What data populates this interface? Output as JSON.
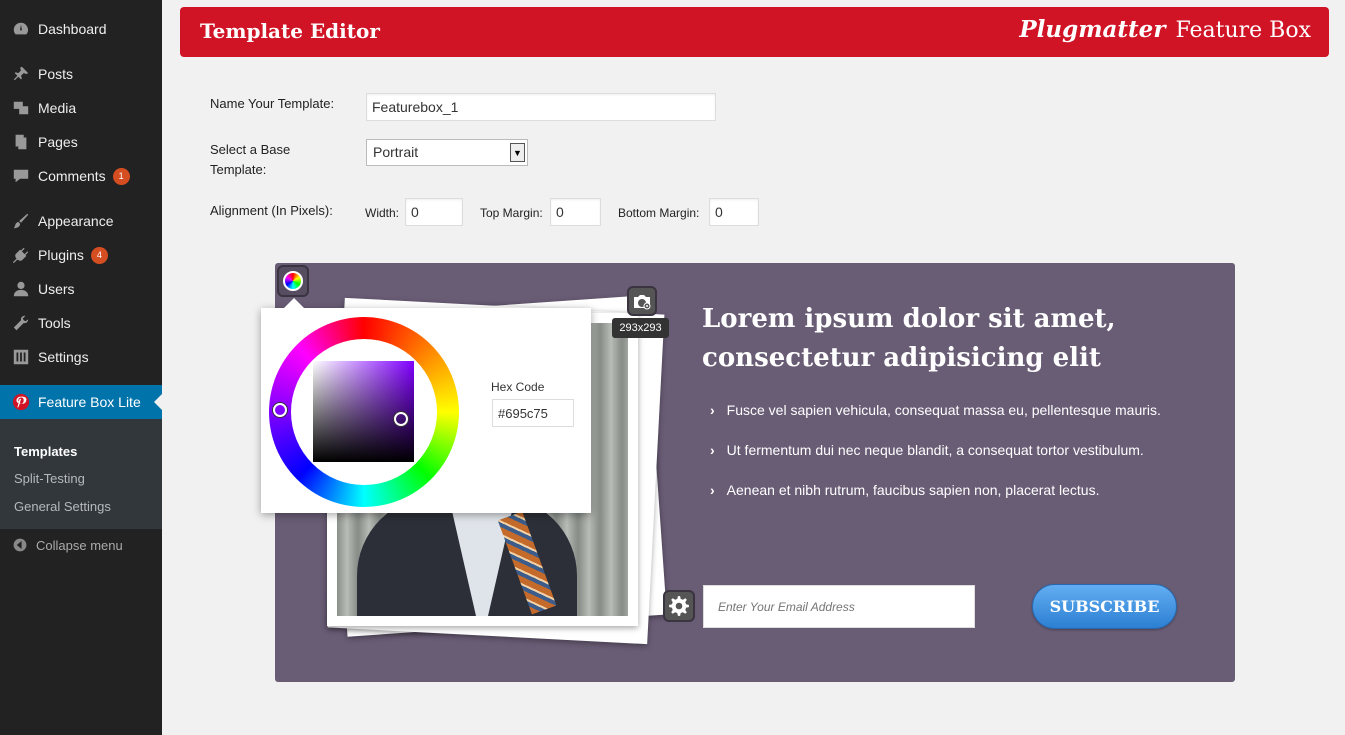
{
  "sidebar": {
    "items": [
      {
        "label": "Dashboard",
        "icon": "dashboard-icon"
      },
      {
        "label": "Posts",
        "icon": "pin-icon"
      },
      {
        "label": "Media",
        "icon": "media-icon"
      },
      {
        "label": "Pages",
        "icon": "pages-icon"
      },
      {
        "label": "Comments",
        "icon": "comment-icon",
        "badge": "1"
      },
      {
        "label": "Appearance",
        "icon": "brush-icon"
      },
      {
        "label": "Plugins",
        "icon": "plug-icon",
        "badge": "4"
      },
      {
        "label": "Users",
        "icon": "user-icon"
      },
      {
        "label": "Tools",
        "icon": "wrench-icon"
      },
      {
        "label": "Settings",
        "icon": "sliders-icon"
      },
      {
        "label": "Feature Box Lite",
        "icon": "pinterest-icon"
      }
    ],
    "submenu": [
      "Templates",
      "Split-Testing",
      "General Settings"
    ],
    "collapse_label": "Collapse menu"
  },
  "header": {
    "title": "Template Editor",
    "brand_name": "Plugmatter",
    "brand_product": "Feature Box"
  },
  "form": {
    "name_label": "Name Your Template:",
    "name_value": "Featurebox_1",
    "base_label_line1": "Select a Base",
    "base_label_line2": "Template:",
    "base_value": "Portrait",
    "alignment_label": "Alignment (In Pixels):",
    "width_label": "Width:",
    "width_value": "0",
    "top_margin_label": "Top Margin:",
    "top_margin_value": "0",
    "bottom_margin_label": "Bottom Margin:",
    "bottom_margin_value": "0"
  },
  "preview": {
    "background_color": "#695c75",
    "image_size": "293x293",
    "headline_line1": "Lorem ipsum dolor sit amet,",
    "headline_line2": "consectetur adipisicing elit",
    "bullets": [
      "Fusce vel sapien vehicula, consequat massa eu, pellentesque mauris.",
      "Ut fermentum dui nec neque blandit, a consequat tortor vestibulum.",
      "Aenean et nibh rutrum, faucibus sapien non, placerat lectus."
    ],
    "email_placeholder": "Enter Your Email Address",
    "subscribe_label": "SUBSCRIBE"
  },
  "color_picker": {
    "hex_label": "Hex Code",
    "hex_value": "#695c75"
  },
  "colors": {
    "header_red": "#d01426",
    "sidebar_bg": "#222222",
    "active_menu": "#0073aa",
    "subscribe_blue": "#2c7fd2"
  }
}
